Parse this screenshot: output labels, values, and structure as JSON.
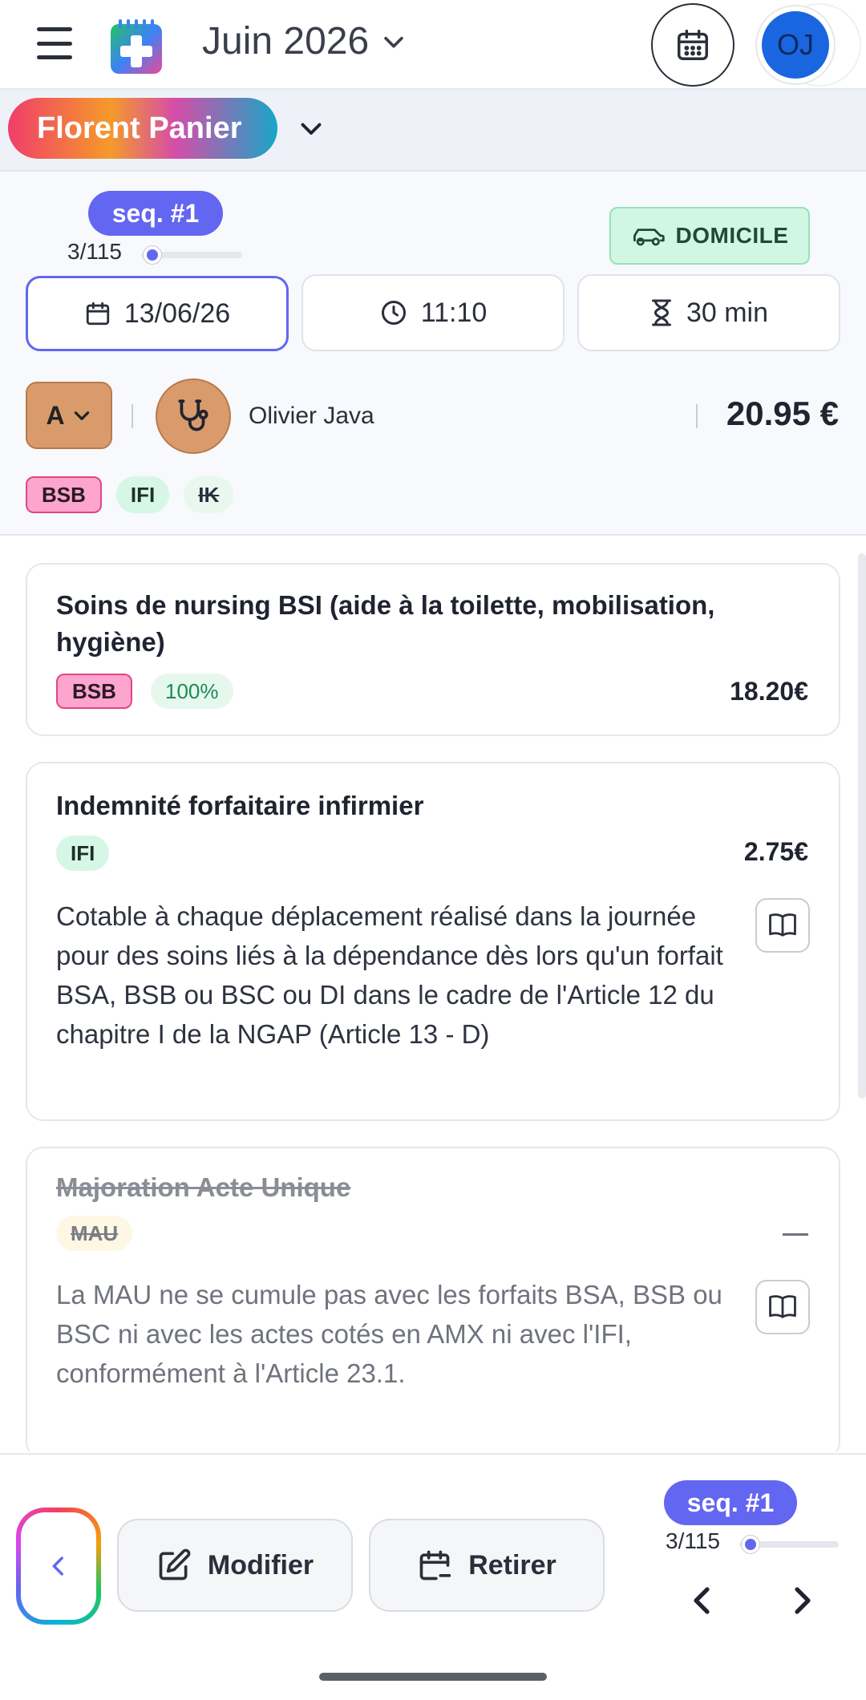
{
  "header": {
    "month_label": "Juin 2026",
    "avatar_initials": "OJ"
  },
  "patient": {
    "name": "Florent Panier"
  },
  "visit": {
    "sequence_label": "seq. #1",
    "progress_label": "3/115",
    "progress_fraction": 0.026,
    "location_label": "DOMICILE",
    "date": "13/06/26",
    "time": "11:10",
    "duration": "30 min",
    "letter": "A",
    "practitioner": "Olivier Java",
    "total": "20.95 €",
    "tags": [
      "BSB",
      "IFI",
      "IK"
    ]
  },
  "acts": [
    {
      "title": "Soins de nursing BSI (aide à la toilette, mobilisation, hygiène)",
      "code": "BSB",
      "rate": "100%",
      "price": "18.20€"
    },
    {
      "title": "Indemnité forfaitaire infirmier",
      "code": "IFI",
      "price": "2.75€",
      "description": "Cotable à chaque déplacement réalisé dans la journée pour des soins liés à la dépendance dès lors qu'un forfait BSA, BSB ou BSC ou DI dans le cadre de l'Article 12 du chapitre I de la NGAP (Article 13 - D)"
    },
    {
      "title": "Majoration Acte Unique",
      "code": "MAU",
      "description": "La MAU ne se cumule pas avec les forfaits BSA, BSB ou BSC ni avec les actes cotés en AMX ni avec l'IFI, conformément à l'Article 23.1."
    }
  ],
  "footer": {
    "modify_label": "Modifier",
    "remove_label": "Retirer",
    "sequence_label": "seq. #1",
    "progress_label": "3/115"
  },
  "colors": {
    "accent": "#6366f1",
    "domicile_bg": "#d1f7e3",
    "practitioner": "#d99b6c",
    "tag_bsb": "#fda4cf",
    "tag_ifi": "#d6f7e6"
  },
  "icons": [
    "menu-icon",
    "app-logo-icon",
    "chevron-down-icon",
    "calendar-icon",
    "car-icon",
    "clock-icon",
    "hourglass-icon",
    "stethoscope-icon",
    "book-icon",
    "edit-icon",
    "calendar-minus-icon",
    "chevron-left-icon",
    "chevron-right-icon"
  ]
}
